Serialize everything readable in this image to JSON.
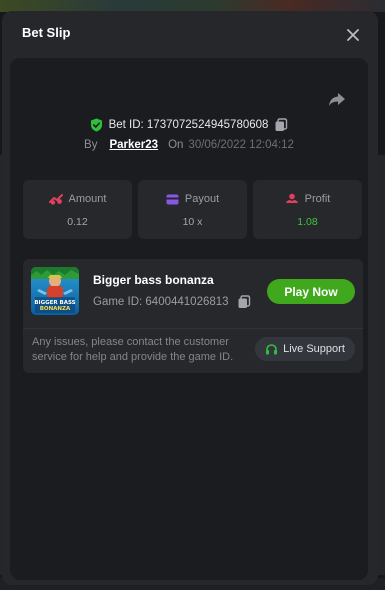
{
  "modal": {
    "title": "Bet Slip"
  },
  "bet": {
    "id_label": "Bet ID: 1737072524945780608",
    "by_label": "By",
    "username": "Parker23",
    "on_label": "On",
    "datetime": "30/06/2022 12:04:12"
  },
  "stats": {
    "amount": {
      "label": "Amount",
      "value": "0.12",
      "icon": "coins-icon",
      "color": "#e0405e"
    },
    "payout": {
      "label": "Payout",
      "value": "10 x",
      "icon": "wallet-icon",
      "color": "#8a56e6"
    },
    "profit": {
      "label": "Profit",
      "value": "1.08",
      "icon": "profit-icon",
      "color": "#e0405e",
      "value_color": "#3fc73d"
    }
  },
  "game": {
    "title": "Bigger bass bonanza",
    "id_label": "Game ID: 6400441026813",
    "thumb_text": "BIGGER BASS BONANZA",
    "play_label": "Play Now"
  },
  "support": {
    "text": "Any issues, please contact the customer service for help and provide the game ID.",
    "button_label": "Live Support"
  },
  "colors": {
    "accent_green": "#3fa81d",
    "shield_green": "#2fbf3a"
  }
}
